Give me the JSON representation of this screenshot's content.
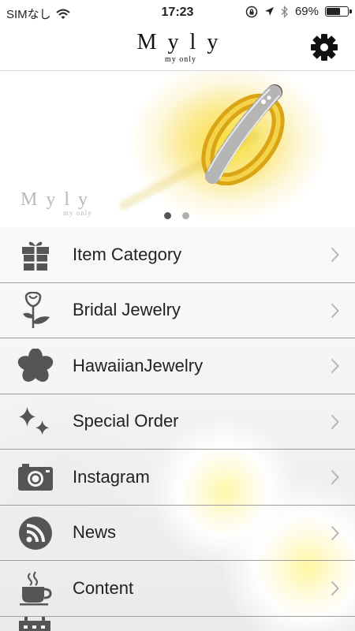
{
  "status_bar": {
    "carrier": "SIMなし",
    "time": "17:23",
    "battery_text": "69%",
    "battery_level": 0.69
  },
  "nav": {
    "logo_main": "Myly",
    "logo_sub": "my only",
    "settings_icon": "gear-icon"
  },
  "hero": {
    "logo_main": "Myly",
    "logo_sub": "my only",
    "page_count": 2,
    "active_page": 1
  },
  "menu": {
    "items": [
      {
        "label": "Item Category",
        "icon": "gift-icon"
      },
      {
        "label": "Bridal Jewelry",
        "icon": "rose-icon"
      },
      {
        "label": "HawaiianJewelry",
        "icon": "flower-icon"
      },
      {
        "label": "Special Order",
        "icon": "sparkle-icon"
      },
      {
        "label": "Instagram",
        "icon": "camera-icon"
      },
      {
        "label": "News",
        "icon": "rss-icon"
      },
      {
        "label": "Content",
        "icon": "coffee-icon"
      }
    ]
  },
  "colors": {
    "icon": "#555555",
    "chevron": "#b5b5b5",
    "divider": "#9e9e9e",
    "ring_gold": "#e2b21a"
  }
}
